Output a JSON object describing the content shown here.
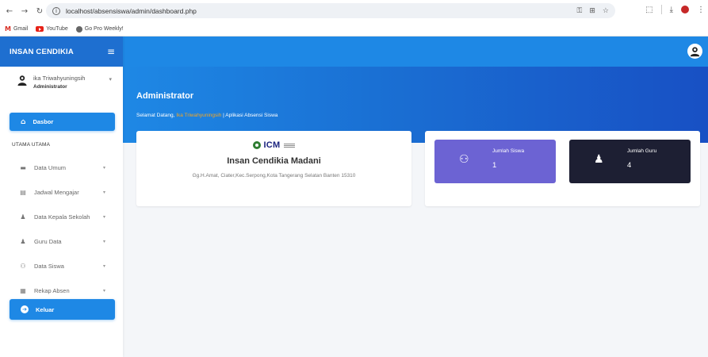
{
  "browser": {
    "url": "localhost/absensiswa/admin/dashboard.php",
    "bookmarks": [
      "Gmail",
      "YouTube",
      "Go Pro Weekly!"
    ]
  },
  "sidebar": {
    "brand": "INSAN CENDIKIA",
    "user": {
      "name": "ika Triwahyuningsih",
      "role": "Administrator"
    },
    "active_item": "Dasbor",
    "section_title": "UTAMA UTAMA",
    "items": [
      {
        "label": "Data Umum",
        "icon": "folder-icon"
      },
      {
        "label": "Jadwal Mengajar",
        "icon": "document-icon"
      },
      {
        "label": "Data Kepala Sekolah",
        "icon": "user-tie-icon"
      },
      {
        "label": "Guru Data",
        "icon": "user-tie-icon"
      },
      {
        "label": "Data Siswa",
        "icon": "users-icon"
      },
      {
        "label": "Rekap Absen",
        "icon": "list-icon"
      }
    ],
    "logout": "Keluar"
  },
  "hero": {
    "title": "Administrator",
    "greeting_prefix": "Selamat Datang,",
    "greeting_name": "Ika Triwahyuningsih",
    "greeting_suffix": "| Aplikasi Absensi Siswa"
  },
  "school": {
    "logo_text": "ICM",
    "name": "Insan Cendikia Madani",
    "address": "Gg.H.Amat, Ciater,Kec.Serpong,Kota Tangerang Selatan Banten 15310"
  },
  "stats": [
    {
      "label": "Jumlah Siswa",
      "value": "1",
      "color": "#6c63d3"
    },
    {
      "label": "Jumlah Guru",
      "value": "4",
      "color": "#1d1f33"
    }
  ],
  "colors": {
    "primary": "#1e88e5",
    "highlight": "#f5a623"
  }
}
